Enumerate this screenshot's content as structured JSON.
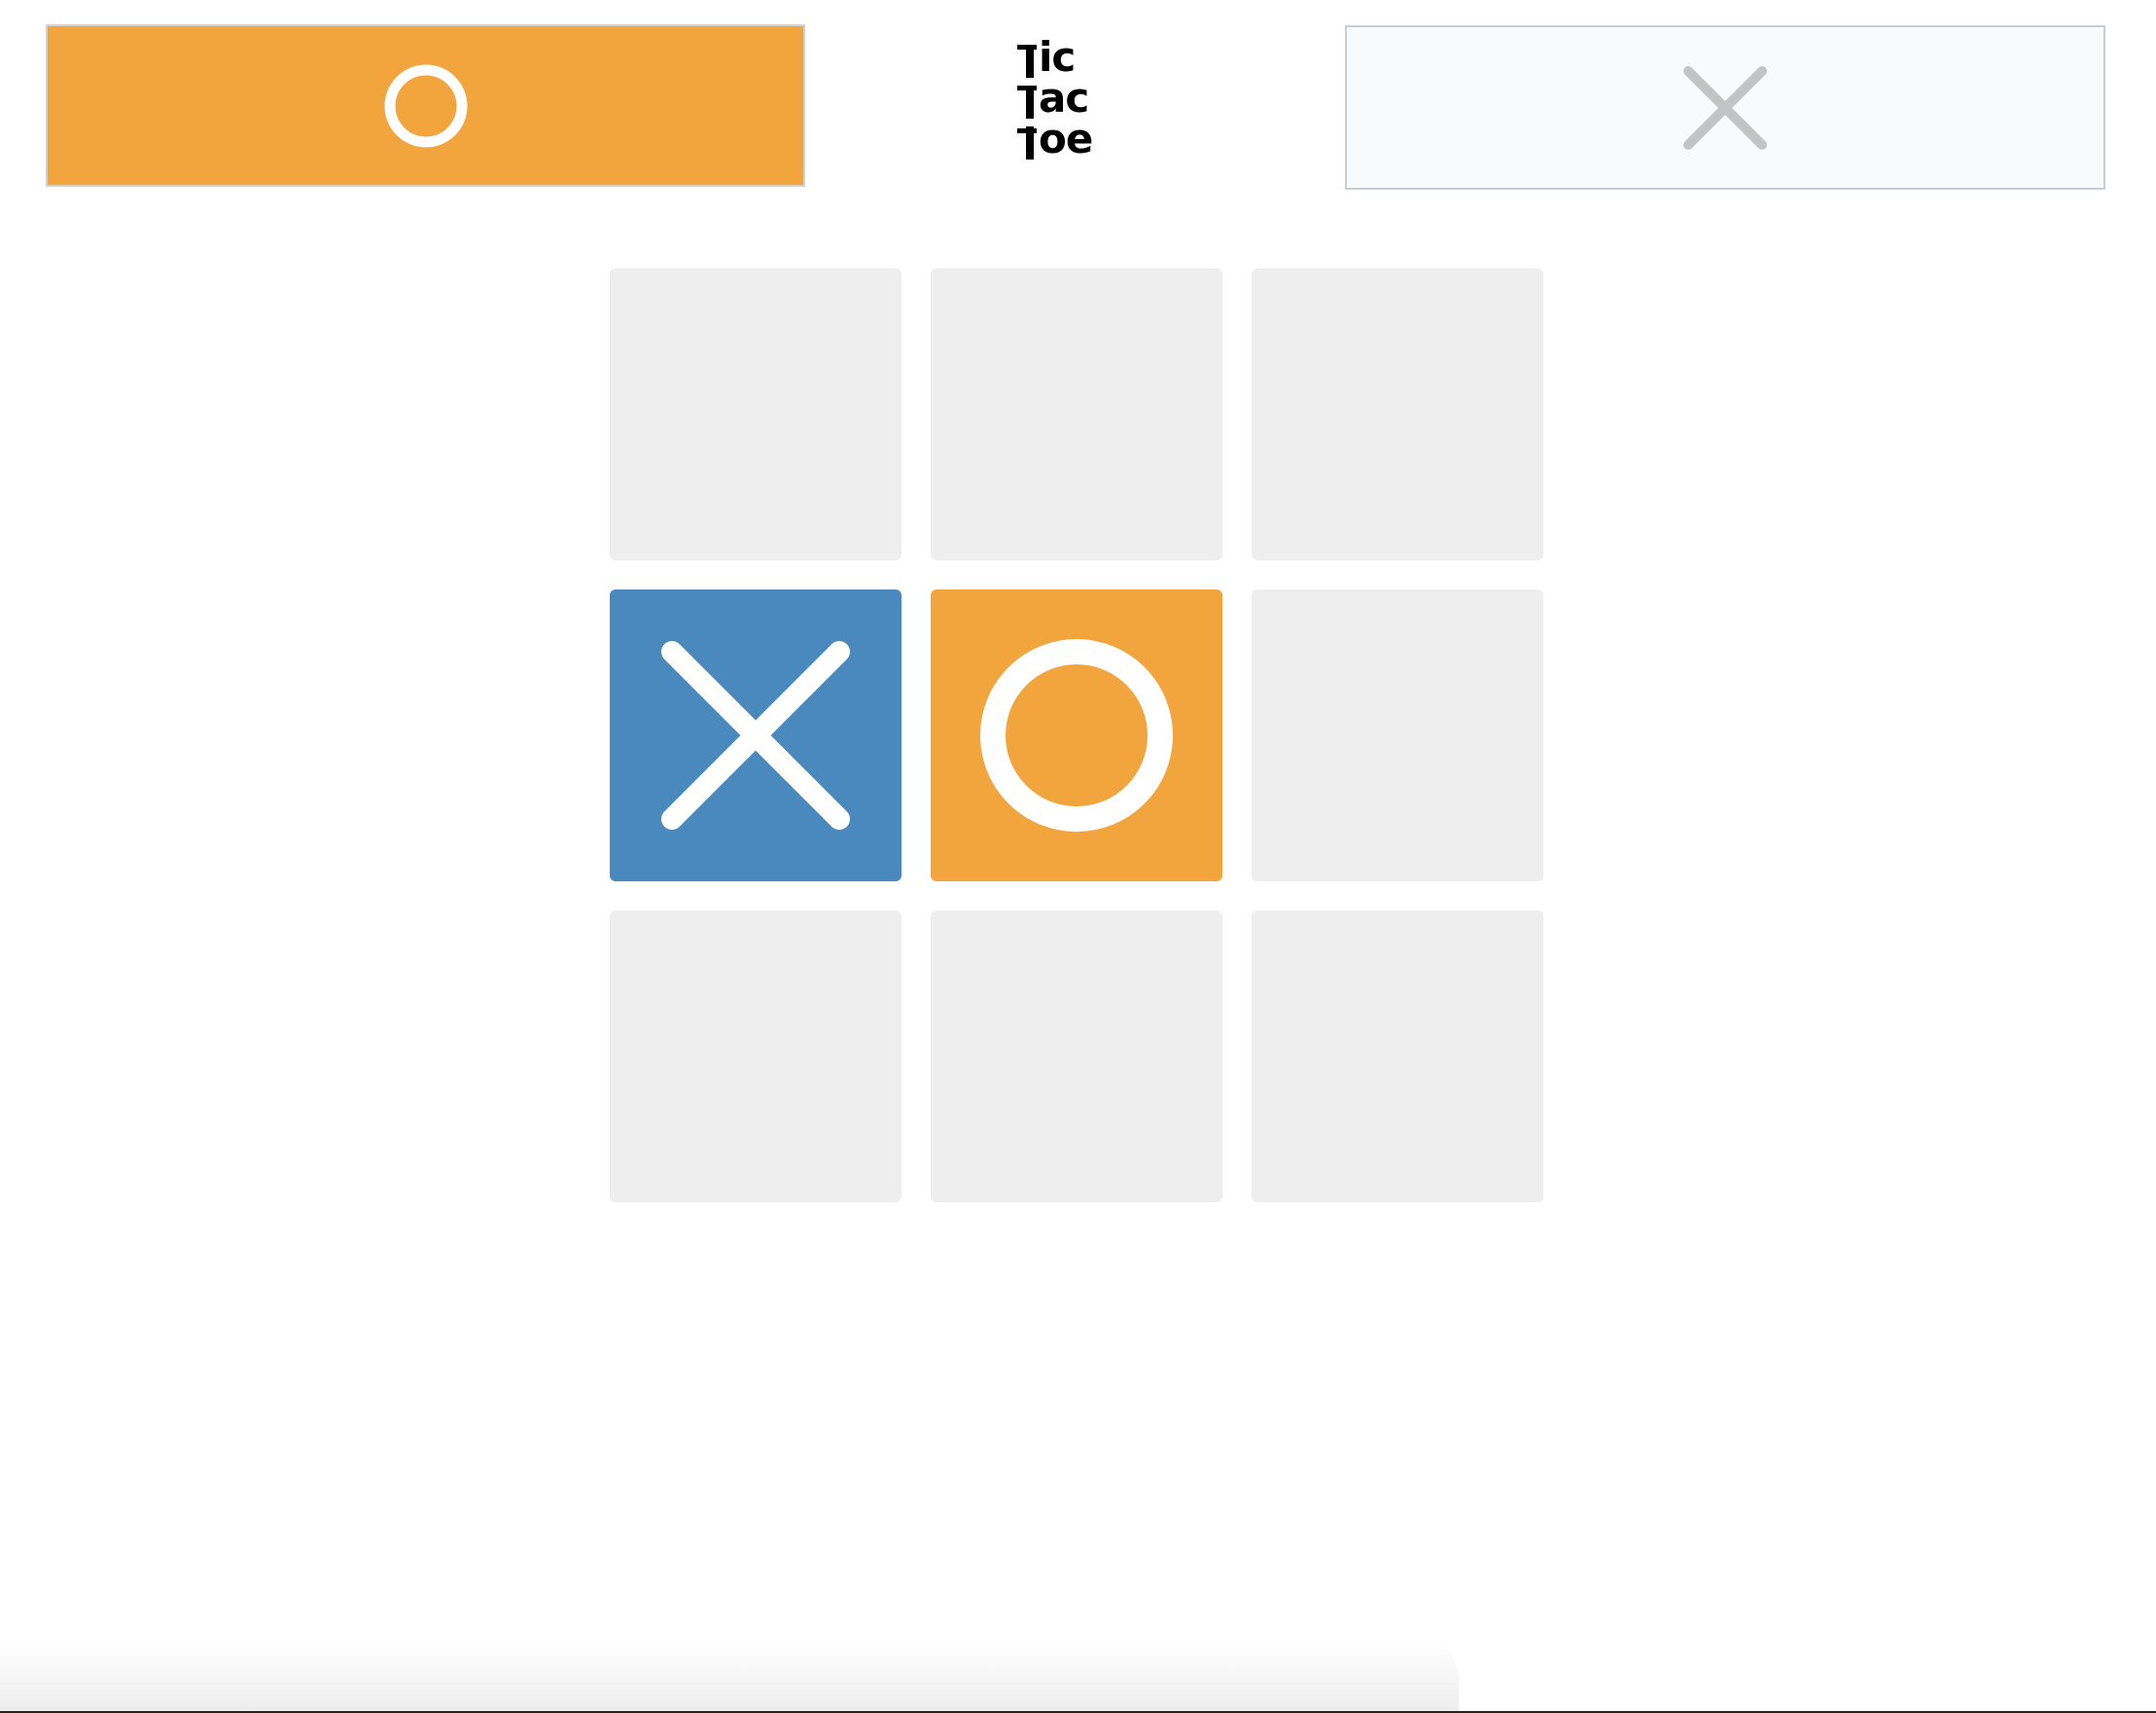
{
  "header": {
    "title_line_1": "ic",
    "title_line_2": "ac",
    "title_line_3": "oe",
    "title_full": "Tic Tac Toe",
    "player_o": {
      "symbol": "O",
      "active": true,
      "color": "#f3a53d"
    },
    "player_x": {
      "symbol": "X",
      "active": false,
      "color": "#c4c4c4"
    }
  },
  "board": {
    "cells": [
      {
        "row": 1,
        "col": 1,
        "mark": ""
      },
      {
        "row": 1,
        "col": 2,
        "mark": ""
      },
      {
        "row": 1,
        "col": 3,
        "mark": ""
      },
      {
        "row": 2,
        "col": 1,
        "mark": "X"
      },
      {
        "row": 2,
        "col": 2,
        "mark": "O"
      },
      {
        "row": 2,
        "col": 3,
        "mark": ""
      },
      {
        "row": 3,
        "col": 1,
        "mark": ""
      },
      {
        "row": 3,
        "col": 2,
        "mark": ""
      },
      {
        "row": 3,
        "col": 3,
        "mark": ""
      }
    ]
  },
  "colors": {
    "x_mark_bg": "#4a89bd",
    "o_mark_bg": "#f3a53d",
    "empty_cell_bg": "#eeeeee",
    "mark_stroke": "#ffffff"
  },
  "icons": {
    "player_o_icon": "circle-icon",
    "player_x_icon": "cross-icon"
  }
}
